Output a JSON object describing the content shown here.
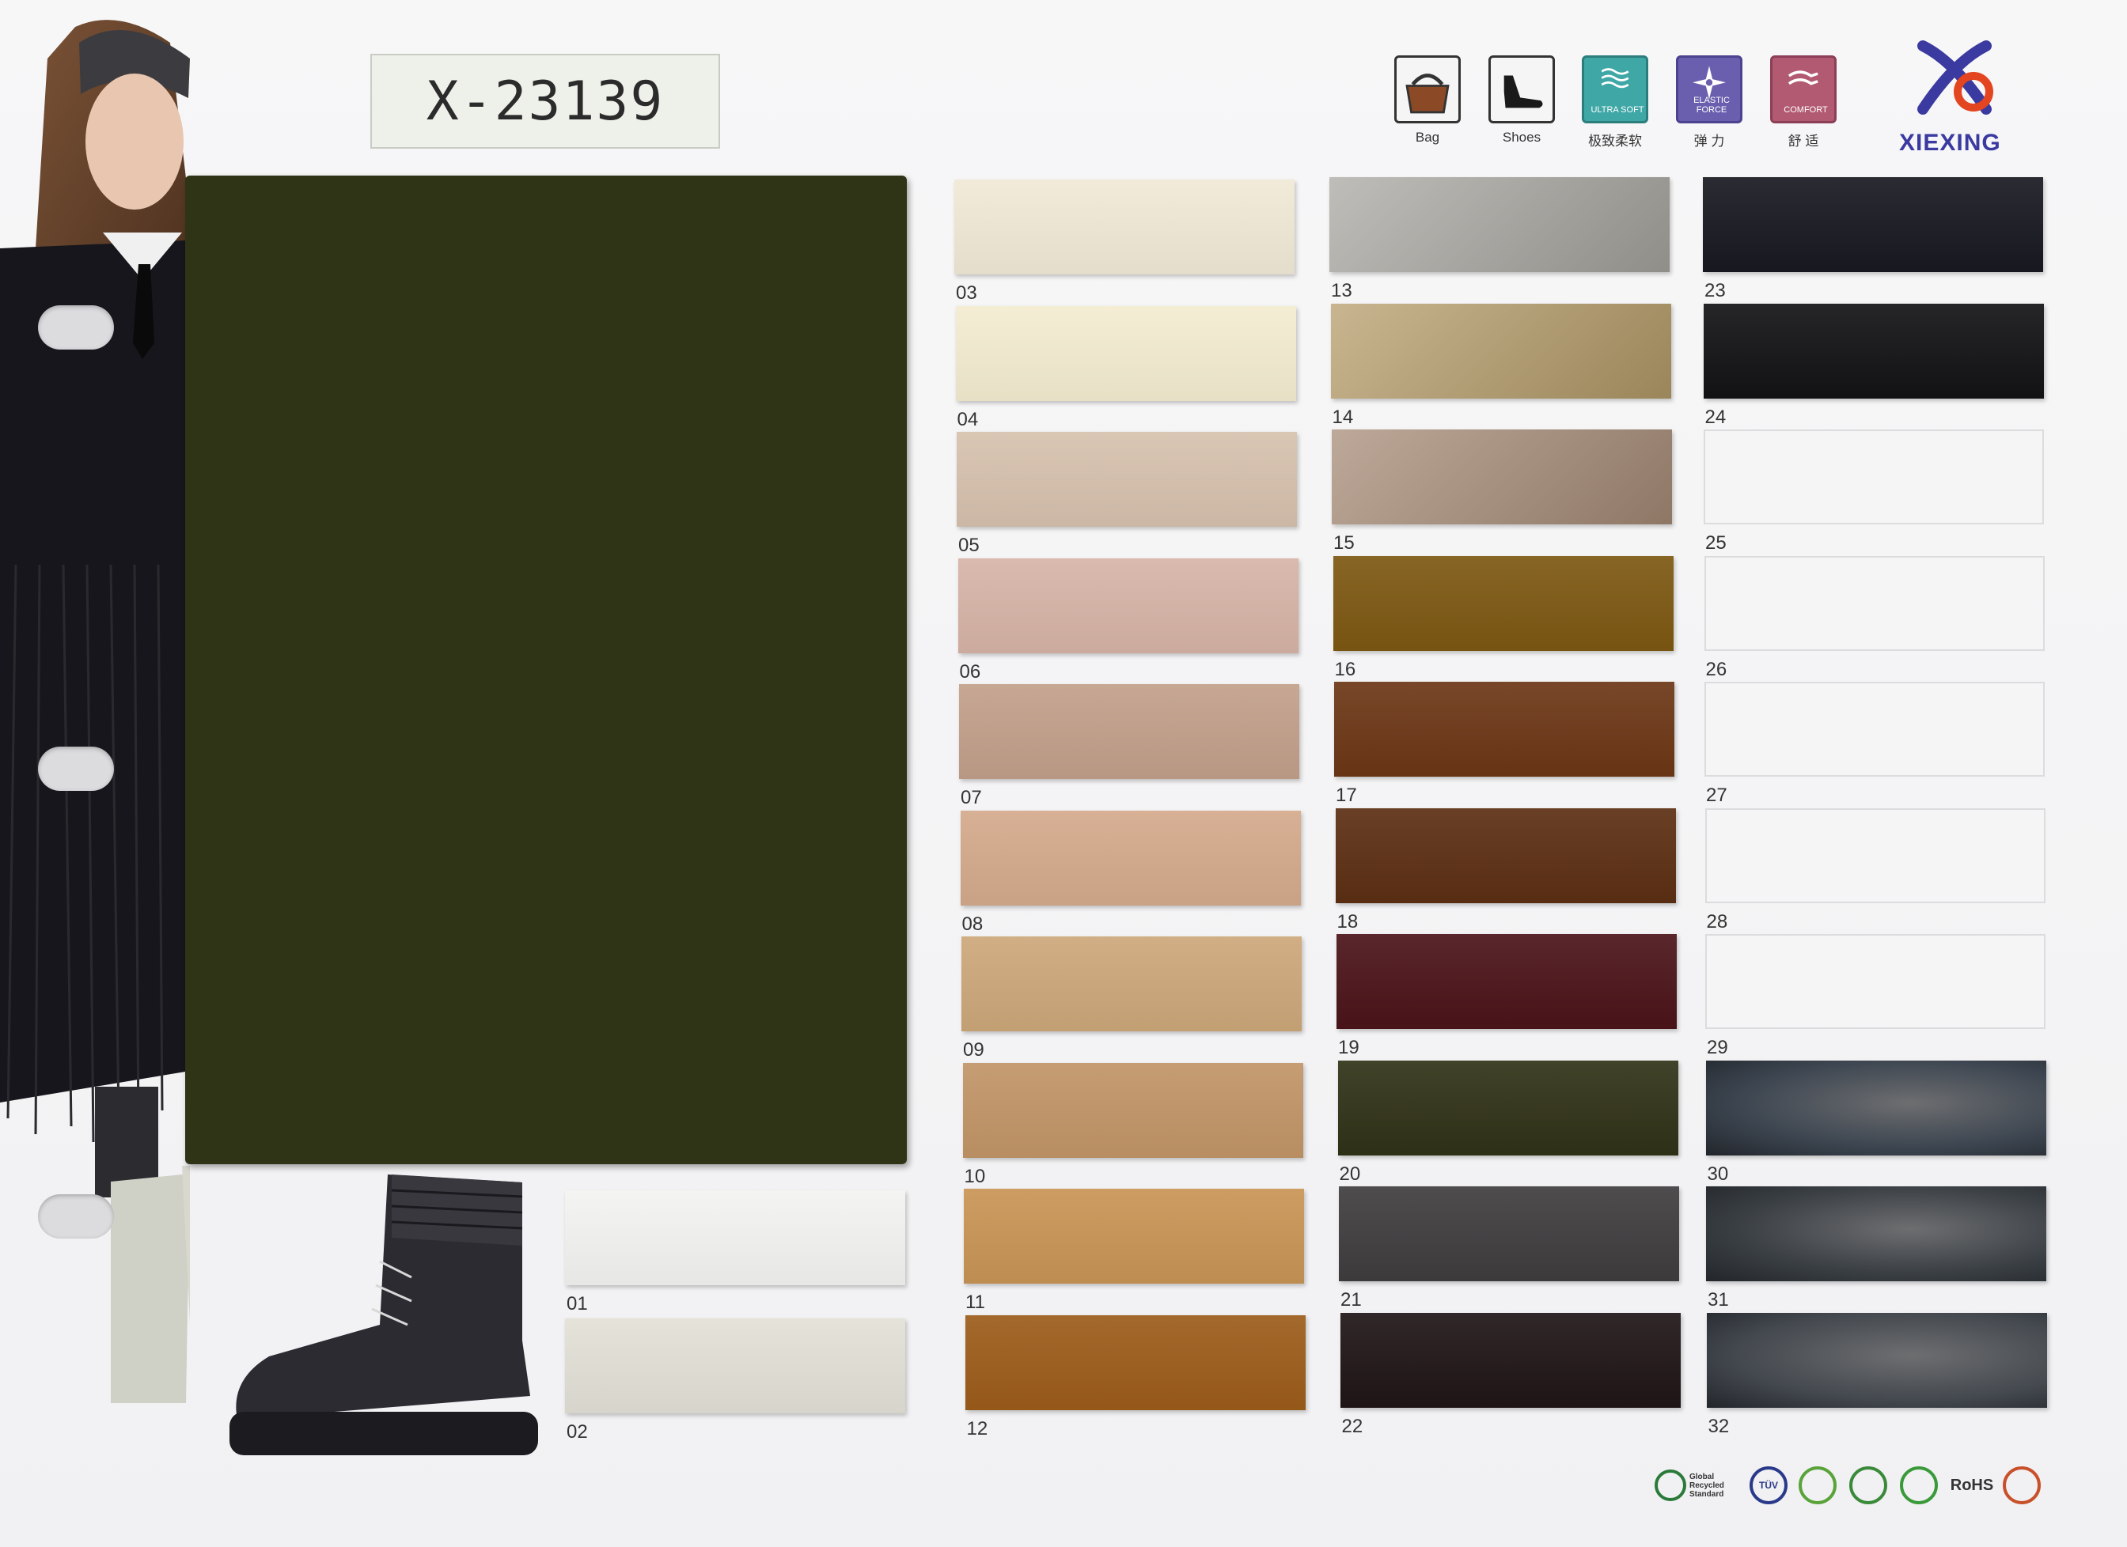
{
  "code_label": "X-23139",
  "icons": [
    {
      "name": "bag",
      "label": "Bag",
      "inner": ""
    },
    {
      "name": "shoes",
      "label": "Shoes",
      "inner": ""
    },
    {
      "name": "ultra-soft",
      "label": "极致柔软",
      "inner": "ULTRA SOFT"
    },
    {
      "name": "elastic-force",
      "label": "弹 力",
      "inner": "ELASTIC FORCE"
    },
    {
      "name": "comfort",
      "label": "舒 适",
      "inner": "COMFORT"
    }
  ],
  "brand": {
    "name": "XIEXING"
  },
  "main_swatch_color": "#2f3416",
  "swatches": [
    {
      "num": "01",
      "color": "#f3f3f1",
      "type": "color"
    },
    {
      "num": "02",
      "color": "#e2e0d6",
      "type": "color"
    },
    {
      "num": "03",
      "color": "#f1e9d6",
      "type": "color"
    },
    {
      "num": "04",
      "color": "#f3ecd0",
      "type": "color"
    },
    {
      "num": "05",
      "color": "#d6c1ad",
      "type": "color"
    },
    {
      "num": "06",
      "color": "#d7b4a7",
      "type": "color"
    },
    {
      "num": "07",
      "color": "#c2a08a",
      "type": "color"
    },
    {
      "num": "08",
      "color": "#d4aa8c",
      "type": "color"
    },
    {
      "num": "09",
      "color": "#cda77a",
      "type": "color"
    },
    {
      "num": "10",
      "color": "#c19567",
      "type": "color"
    },
    {
      "num": "11",
      "color": "#c89455",
      "type": "color"
    },
    {
      "num": "12",
      "color": "#9c5c1a",
      "type": "color"
    },
    {
      "num": "13",
      "color": "#a9a7a1",
      "type": "metallic"
    },
    {
      "num": "14",
      "color": "#b69d6a",
      "type": "metallic"
    },
    {
      "num": "15",
      "color": "#a78c77",
      "type": "metallic"
    },
    {
      "num": "16",
      "color": "#7d5812",
      "type": "color"
    },
    {
      "num": "17",
      "color": "#6c3716",
      "type": "color"
    },
    {
      "num": "18",
      "color": "#5c2f13",
      "type": "color"
    },
    {
      "num": "19",
      "color": "#4b1419",
      "type": "color"
    },
    {
      "num": "20",
      "color": "#303217",
      "type": "color"
    },
    {
      "num": "21",
      "color": "#3f3d3e",
      "type": "color"
    },
    {
      "num": "22",
      "color": "#1f1516",
      "type": "color"
    },
    {
      "num": "23",
      "color": "#181921",
      "type": "color"
    },
    {
      "num": "24",
      "color": "#131315",
      "type": "color"
    },
    {
      "num": "25",
      "color": "#f5f5f6",
      "type": "empty"
    },
    {
      "num": "26",
      "color": "#f5f5f6",
      "type": "empty"
    },
    {
      "num": "27",
      "color": "#f5f5f6",
      "type": "empty"
    },
    {
      "num": "28",
      "color": "#f5f5f6",
      "type": "empty"
    },
    {
      "num": "29",
      "color": "#f5f5f6",
      "type": "empty"
    },
    {
      "num": "30",
      "color": "#3c4550",
      "type": "photo"
    },
    {
      "num": "31",
      "color": "#3a3f44",
      "type": "photo"
    },
    {
      "num": "32",
      "color": "#44494f",
      "type": "photo"
    }
  ],
  "certifications": [
    {
      "name": "global-recycled-standard",
      "label": "Global Recycled Standard"
    },
    {
      "name": "tuv",
      "label": "TÜV"
    },
    {
      "name": "eco-leaf",
      "label": ""
    },
    {
      "name": "check-seal",
      "label": ""
    },
    {
      "name": "green-leaf",
      "label": ""
    },
    {
      "name": "rohs",
      "label": "RoHS"
    },
    {
      "name": "recycle-mark",
      "label": ""
    }
  ]
}
